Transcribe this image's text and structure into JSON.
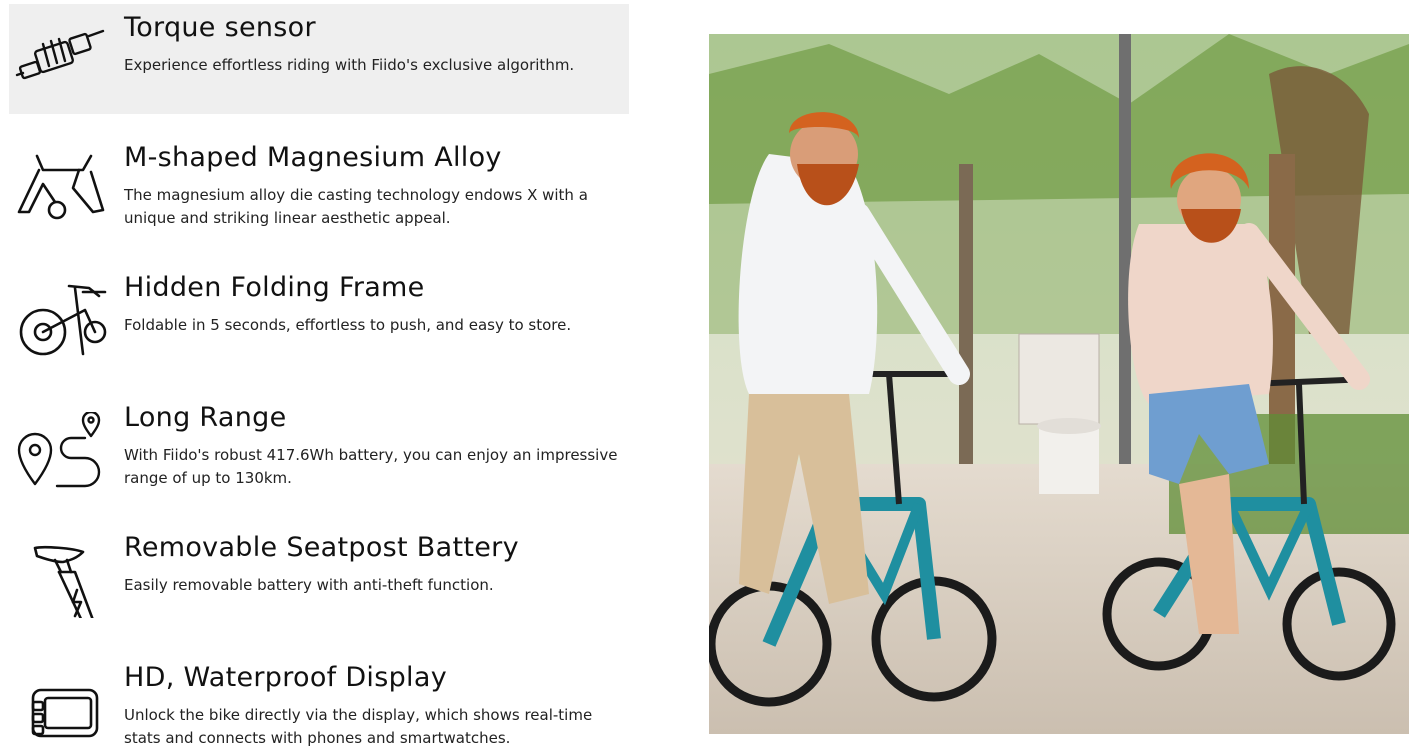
{
  "features": [
    {
      "title": "Torque sensor",
      "description": "Experience effortless riding with Fiido's exclusive algorithm.",
      "icon": "torque-sensor-icon",
      "active": true
    },
    {
      "title": "M-shaped Magnesium Alloy",
      "description": "The magnesium alloy die casting technology endows X with a unique and striking linear aesthetic appeal.",
      "icon": "frame-icon",
      "active": false
    },
    {
      "title": "Hidden Folding Frame",
      "description": "Foldable in 5 seconds, effortless to push, and easy to store.",
      "icon": "folding-bike-icon",
      "active": false
    },
    {
      "title": "Long Range",
      "description": "With Fiido's robust 417.6Wh battery, you can enjoy an impressive range of up to 130km.",
      "icon": "route-pin-icon",
      "active": false
    },
    {
      "title": "Removable Seatpost Battery",
      "description": "Easily removable battery with anti-theft function.",
      "icon": "seatpost-battery-icon",
      "active": false
    },
    {
      "title": "HD, Waterproof Display",
      "description": "Unlock the bike directly via the display, which shows real-time stats and connects with phones and smartwatches.",
      "icon": "display-icon",
      "active": false
    }
  ],
  "colors": {
    "active_bg": "#efefef",
    "text": "#111111",
    "bike_teal": "#1f8fa0"
  }
}
